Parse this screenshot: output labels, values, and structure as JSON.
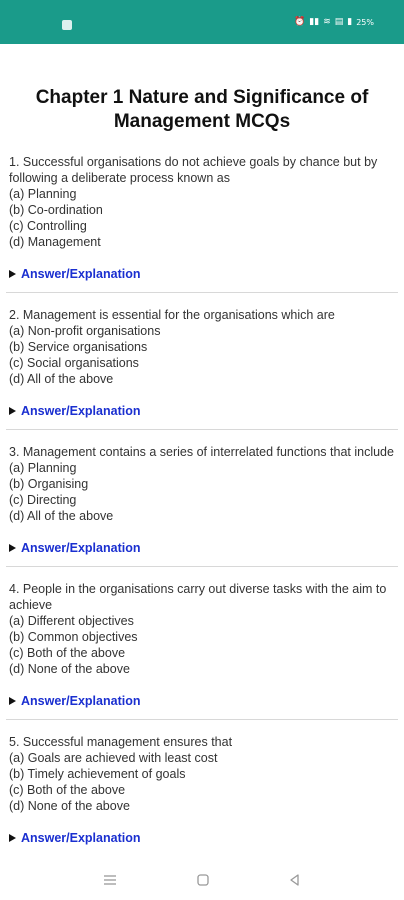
{
  "status_bar": {
    "right_text": "25%",
    "icons": [
      "alarm-icon",
      "signal-icon",
      "wifi-icon",
      "volte-icon",
      "battery-icon"
    ]
  },
  "page": {
    "title": "Chapter 1 Nature and Significance of Management MCQs"
  },
  "questions": [
    {
      "text": "1. Successful organisations do not achieve goals by chance but by following a deliberate process known as",
      "options": [
        "(a) Planning",
        "(b) Co-ordination",
        "(c) Controlling",
        "(d) Management"
      ],
      "answer_label": "Answer/Explanation"
    },
    {
      "text": "2. Management is essential for the organisations which are",
      "options": [
        "(a) Non-profit organisations",
        "(b) Service organisations",
        "(c) Social organisations",
        "(d) All of the above"
      ],
      "answer_label": "Answer/Explanation"
    },
    {
      "text": "3. Management contains a series of interrelated functions that include",
      "options": [
        "(a) Planning",
        "(b) Organising",
        "(c) Directing",
        "(d) All of the above"
      ],
      "answer_label": "Answer/Explanation"
    },
    {
      "text": "4. People in the organisations carry out diverse tasks with the aim to achieve",
      "options": [
        "(a) Different objectives",
        "(b) Common objectives",
        "(c) Both of the above",
        "(d) None of the above"
      ],
      "answer_label": "Answer/Explanation"
    },
    {
      "text": "5. Successful management ensures that",
      "options": [
        "(a) Goals are achieved with least cost",
        "(b) Timely achievement of goals",
        "(c) Both of the above",
        "(d) None of the above"
      ],
      "answer_label": "Answer/Explanation"
    }
  ],
  "colors": {
    "status_bar": "#1a9b8a",
    "answer_link": "#1a2fd0"
  },
  "nav": {
    "icons": [
      "menu-icon",
      "home-icon",
      "back-icon"
    ]
  }
}
